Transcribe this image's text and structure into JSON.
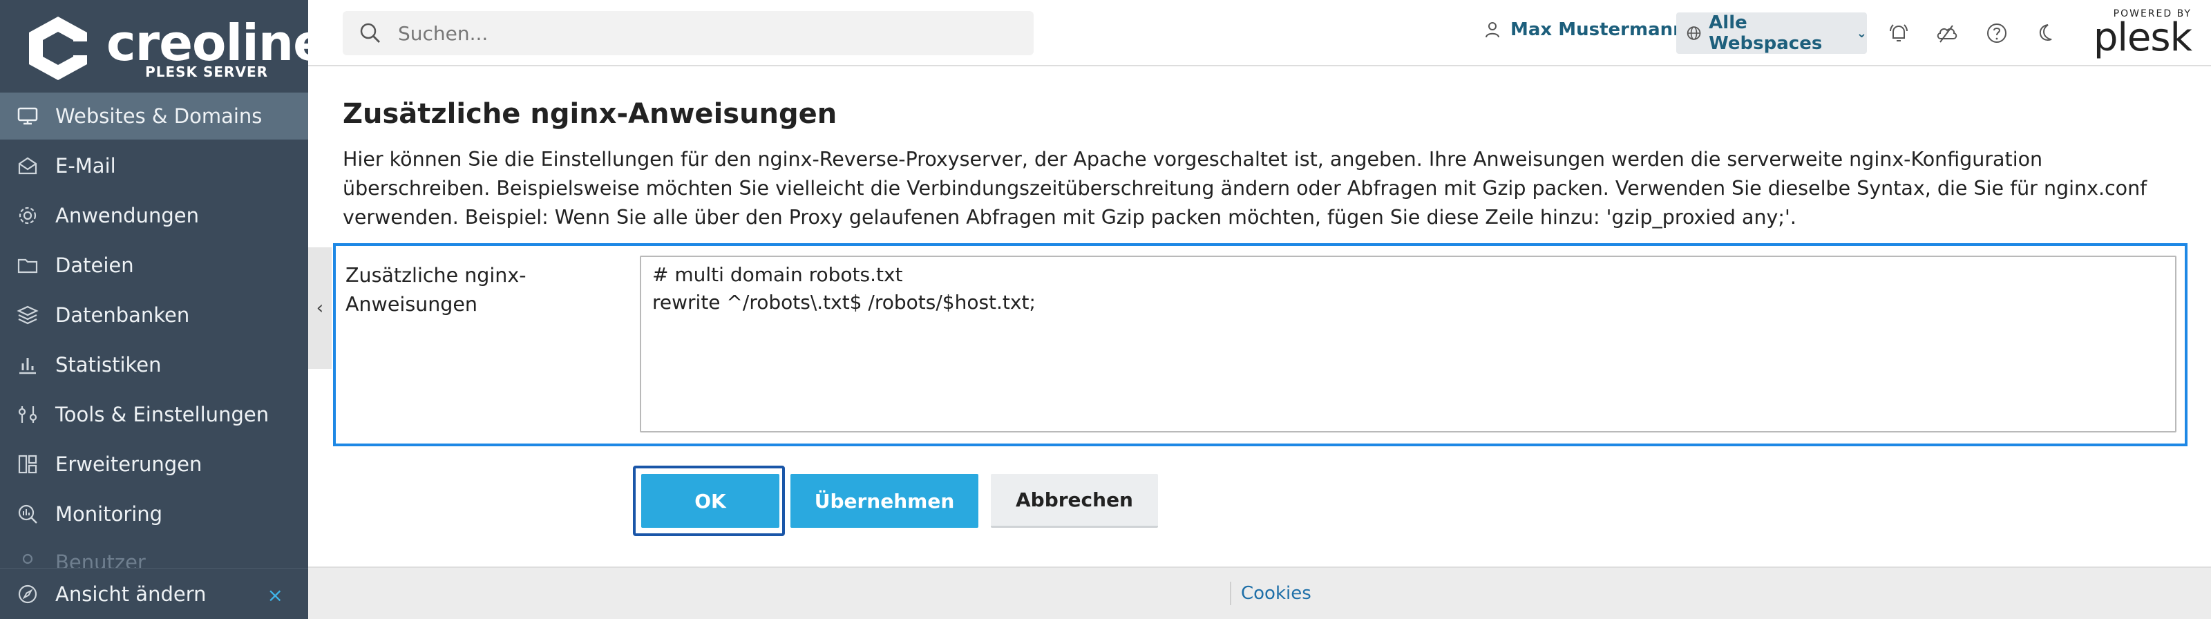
{
  "brand": {
    "name": "creoline",
    "subtitle": "PLESK SERVER"
  },
  "sidebar": {
    "items": [
      {
        "label": "Websites & Domains",
        "icon": "monitor-icon",
        "active": true
      },
      {
        "label": "E-Mail",
        "icon": "mail-icon"
      },
      {
        "label": "Anwendungen",
        "icon": "gear-icon"
      },
      {
        "label": "Dateien",
        "icon": "folder-icon"
      },
      {
        "label": "Datenbanken",
        "icon": "database-icon"
      },
      {
        "label": "Statistiken",
        "icon": "bar-chart-icon"
      },
      {
        "label": "Tools & Einstellungen",
        "icon": "tools-icon"
      },
      {
        "label": "Erweiterungen",
        "icon": "extensions-icon"
      },
      {
        "label": "Monitoring",
        "icon": "monitoring-icon"
      },
      {
        "label": "Benutzer",
        "icon": "users-icon"
      }
    ],
    "change_view": {
      "label": "Ansicht ändern",
      "close": "×"
    }
  },
  "topbar": {
    "search_placeholder": "Suchen...",
    "user_name": "Max Mustermann",
    "webspaces_label": "Alle Webspaces",
    "powered_by": "POWERED BY",
    "plesk_logo": "plesk"
  },
  "main": {
    "title": "Zusätzliche nginx-Anweisungen",
    "description": "Hier können Sie die Einstellungen für den nginx-Reverse-Proxyserver, der Apache vorgeschaltet ist, angeben. Ihre Anweisungen werden die serverweite nginx-Konfiguration überschreiben. Beispielsweise möchten Sie vielleicht die Verbindungszeitüberschreitung ändern oder Abfragen mit Gzip packen. Verwenden Sie dieselbe Syntax, die Sie für nginx.conf verwenden. Beispiel: Wenn Sie alle über den Proxy gelaufenen Abfragen mit Gzip packen möchten, fügen Sie diese Zeile hinzu: 'gzip_proxied any;'.",
    "field_label": "Zusätzliche nginx-Anweisungen",
    "field_value": "# multi domain robots.txt\nrewrite ^/robots\\.txt$ /robots/$host.txt;",
    "buttons": {
      "ok": "OK",
      "apply": "Übernehmen",
      "cancel": "Abbrechen"
    }
  },
  "footer": {
    "cookies": "Cookies"
  },
  "colors": {
    "sidebar_bg": "#3b4a5a",
    "sidebar_active": "#5b6f80",
    "primary_button": "#2aa9df",
    "focus_border": "#1e88e5",
    "link": "#1e6fa8"
  }
}
